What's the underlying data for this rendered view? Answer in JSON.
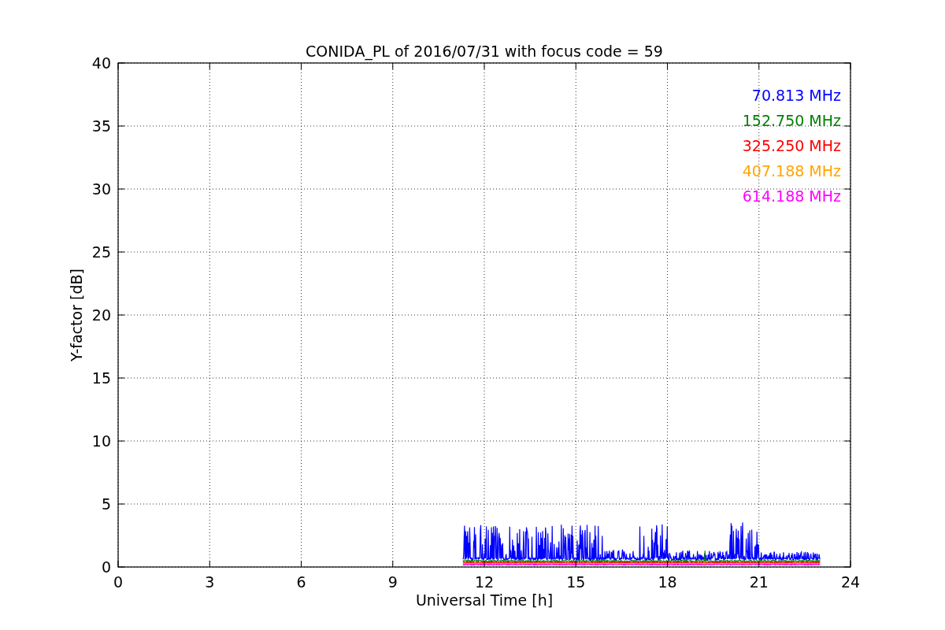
{
  "chart": {
    "title": "CONIDA_PL of 2016/07/31 with focus code = 59",
    "xlabel": "Universal Time [h]",
    "ylabel": "Y-factor [dB]",
    "xticks": [
      "0",
      "3",
      "6",
      "9",
      "12",
      "15",
      "18",
      "21",
      "24"
    ],
    "yticks": [
      "40",
      "35",
      "30",
      "25",
      "20",
      "15",
      "10",
      "5",
      "0"
    ],
    "legend": [
      {
        "label": "70.813 MHz",
        "color": "#0000ff"
      },
      {
        "label": "152.750 MHz",
        "color": "#008000"
      },
      {
        "label": "325.250 MHz",
        "color": "#ff0000"
      },
      {
        "label": "407.188 MHz",
        "color": "#ffa500"
      },
      {
        "label": "614.188 MHz",
        "color": "#ff00ff"
      }
    ]
  }
}
